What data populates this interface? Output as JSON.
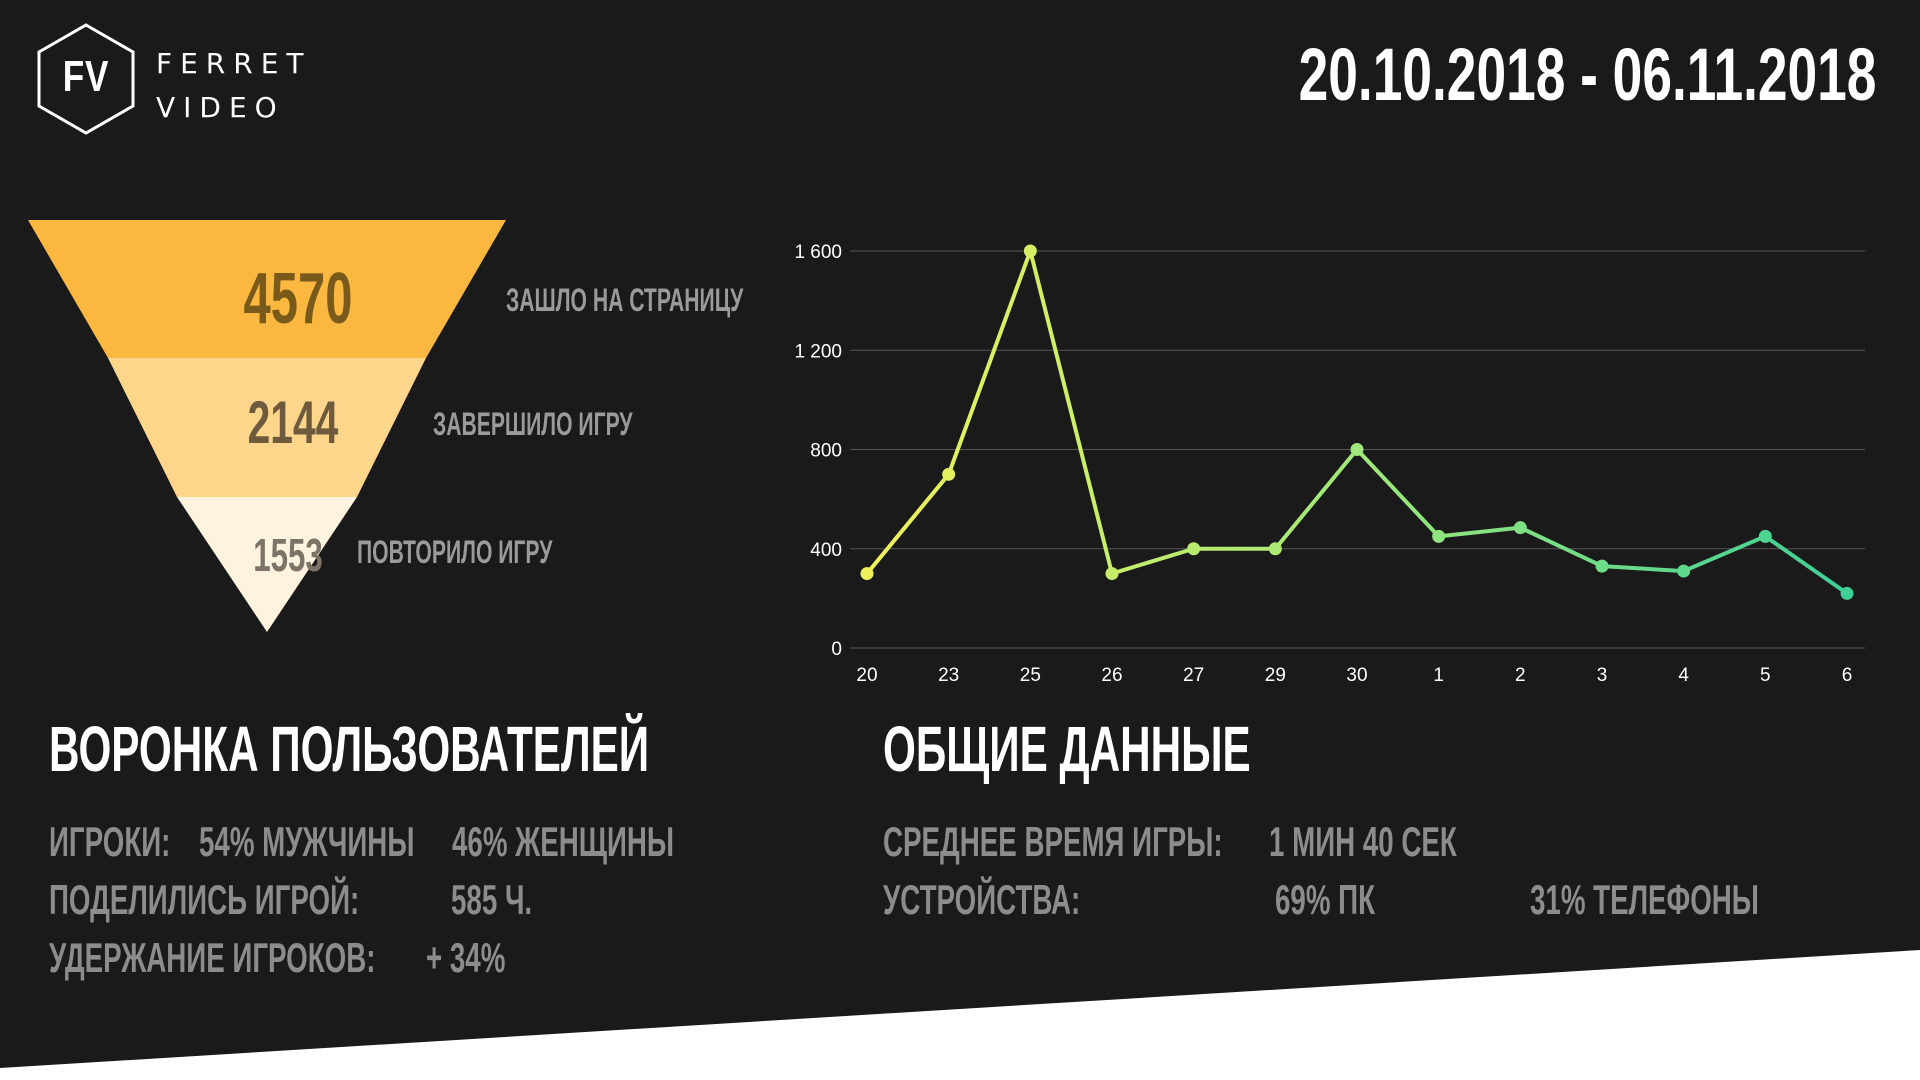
{
  "logo": {
    "mark": "FV",
    "line1": "FERRET",
    "line2": "VIDEO"
  },
  "date_range": "20.10.2018 - 06.11.2018",
  "funnel": {
    "steps": [
      {
        "value": "4570",
        "label": "ЗАШЛО НА СТРАНИЦУ",
        "color": "#fbb840"
      },
      {
        "value": "2144",
        "label": "ЗАВЕРШИЛО ИГРУ",
        "color": "#fdd68c"
      },
      {
        "value": "1553",
        "label": "ПОВТОРИЛО ИГРУ",
        "color": "#fef3df"
      }
    ]
  },
  "left_section": {
    "title": "ВОРОНКА ПОЛЬЗОВАТЕЛЕЙ",
    "players_label": "ИГРОКИ:",
    "players_male": "54% МУЖЧИНЫ",
    "players_female": "46% ЖЕНЩИНЫ",
    "shared_label": "ПОДЕЛИЛИСЬ ИГРОЙ:",
    "shared_value": "585 Ч.",
    "retention_label": "УДЕРЖАНИЕ ИГРОКОВ:",
    "retention_value": "+ 34%"
  },
  "right_section": {
    "title": "ОБЩИЕ ДАННЫЕ",
    "avg_time_label": "СРЕДНЕЕ ВРЕМЯ ИГРЫ:",
    "avg_time_value": "1 МИН 40 СЕК",
    "devices_label": "УСТРОЙСТВА:",
    "devices_pc": "69% ПК",
    "devices_phones": "31% ТЕЛЕФОНЫ"
  },
  "colors": {
    "background": "#1a1a1a",
    "line_start": "#eef25a",
    "line_mid": "#9fe87a",
    "line_end": "#3ecf96",
    "grid": "#555555"
  },
  "chart_data": {
    "type": "line",
    "title": "",
    "xlabel": "",
    "ylabel": "",
    "categories": [
      "20",
      "23",
      "25",
      "26",
      "27",
      "29",
      "30",
      "1",
      "2",
      "3",
      "4",
      "5",
      "6"
    ],
    "series": [
      {
        "values": [
          300,
          700,
          1600,
          300,
          400,
          400,
          800,
          450,
          485,
          330,
          310,
          450,
          220
        ]
      }
    ],
    "yticks": [
      "0",
      "400",
      "800",
      "1 200",
      "1 600"
    ],
    "ytick_values": [
      0,
      400,
      800,
      1200,
      1600
    ],
    "ylim": [
      0,
      1600
    ],
    "grid": true,
    "legend": "none"
  }
}
